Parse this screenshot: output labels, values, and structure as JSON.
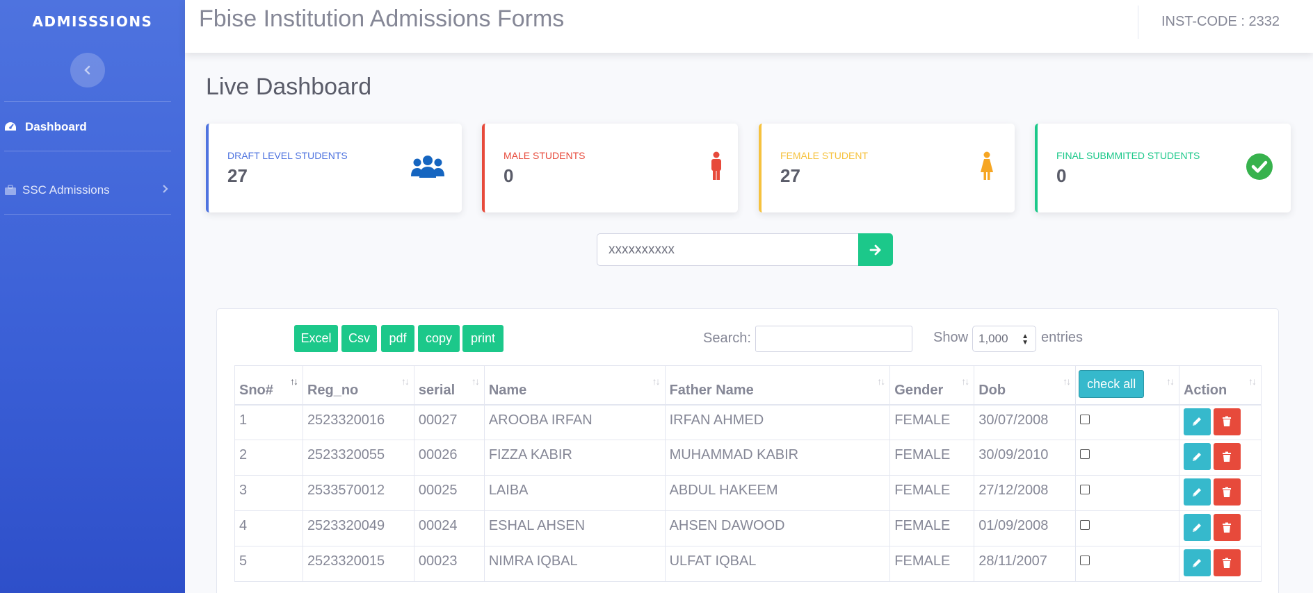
{
  "sidebar": {
    "brand": "ADMISSSIONS",
    "items": [
      {
        "label": "Dashboard"
      },
      {
        "label": "SSC Admissions"
      }
    ]
  },
  "topbar": {
    "title": "Fbise Institution Admissions Forms",
    "inst_code": "INST-CODE : 2332"
  },
  "page": {
    "heading": "Live Dashboard"
  },
  "cards": [
    {
      "label": "DRAFT LEVEL STUDENTS",
      "value": "27",
      "color": "#4e73df",
      "icon": "users-icon"
    },
    {
      "label": "MALE STUDENTS",
      "value": "0",
      "color": "#e74a3b",
      "icon": "male-icon"
    },
    {
      "label": "FEMALE STUDENT",
      "value": "27",
      "color": "#f6c23e",
      "icon": "female-icon"
    },
    {
      "label": "FINAL SUBMMITED STUDENTS",
      "value": "0",
      "color": "#1cc88a",
      "icon": "check-circle-icon"
    }
  ],
  "lookup": {
    "value": "xxxxxxxxxx"
  },
  "toolbar": {
    "excel": "Excel",
    "csv": "Csv",
    "pdf": "pdf",
    "copy": "copy",
    "print": "print",
    "search_label": "Search:",
    "show_label": "Show",
    "show_value": "1,000",
    "entries_label": "entries"
  },
  "table": {
    "headers": [
      "Sno#",
      "Reg_no",
      "serial",
      "Name",
      "Father Name",
      "Gender",
      "Dob",
      "check all",
      "Action"
    ],
    "rows": [
      {
        "sno": "1",
        "reg": "2523320016",
        "serial": "00027",
        "name": "AROOBA IRFAN",
        "father": "IRFAN AHMED",
        "gender": "FEMALE",
        "dob": "30/07/2008"
      },
      {
        "sno": "2",
        "reg": "2523320055",
        "serial": "00026",
        "name": "FIZZA KABIR",
        "father": "MUHAMMAD KABIR",
        "gender": "FEMALE",
        "dob": "30/09/2010"
      },
      {
        "sno": "3",
        "reg": "2533570012",
        "serial": "00025",
        "name": "LAIBA",
        "father": "ABDUL HAKEEM",
        "gender": "FEMALE",
        "dob": "27/12/2008"
      },
      {
        "sno": "4",
        "reg": "2523320049",
        "serial": "00024",
        "name": "ESHAL AHSEN",
        "father": "AHSEN DAWOOD",
        "gender": "FEMALE",
        "dob": "01/09/2008"
      },
      {
        "sno": "5",
        "reg": "2523320015",
        "serial": "00023",
        "name": "NIMRA IQBAL",
        "father": "ULFAT IQBAL",
        "gender": "FEMALE",
        "dob": "28/11/2007"
      }
    ]
  }
}
